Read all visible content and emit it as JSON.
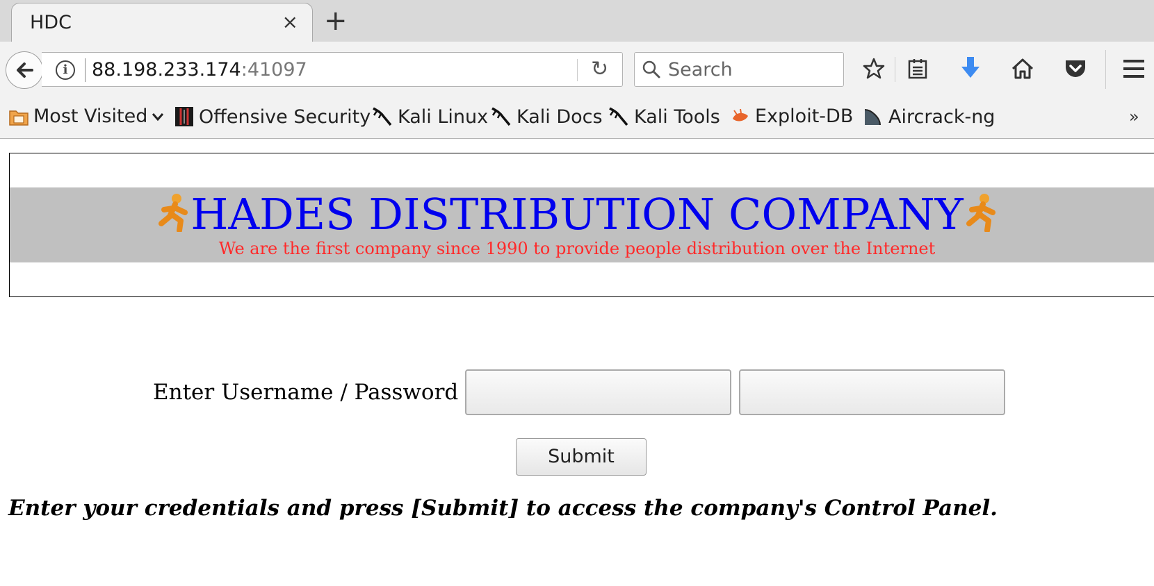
{
  "tab": {
    "title": "HDC",
    "close": "×",
    "new_tab": "+"
  },
  "navbar": {
    "url_host": "88.198.233.174",
    "url_port": ":41097",
    "search_placeholder": "Search"
  },
  "bookmarks": [
    {
      "label": "Most Visited",
      "icon": "folder-icon"
    },
    {
      "label": "Offensive Security",
      "icon": "offsec-icon"
    },
    {
      "label": "Kali Linux",
      "icon": "kali-icon"
    },
    {
      "label": "Kali Docs",
      "icon": "kali-icon"
    },
    {
      "label": "Kali Tools",
      "icon": "kali-icon"
    },
    {
      "label": "Exploit-DB",
      "icon": "exploitdb-icon"
    },
    {
      "label": "Aircrack-ng",
      "icon": "aircrack-icon"
    }
  ],
  "bookmarks_overflow": "»",
  "banner": {
    "title": "HADES DISTRIBUTION COMPANY",
    "subtitle": "We are the first company since 1990 to provide people distribution over the Internet",
    "title_color": "#0000ee",
    "subtitle_color": "#ff2a2a",
    "band_color": "#c0c0c0"
  },
  "login": {
    "label": "Enter Username / Password",
    "username_value": "",
    "password_value": "",
    "submit_label": "Submit"
  },
  "instructions": "Enter your credentials and press [Submit] to access the company's Control Panel."
}
